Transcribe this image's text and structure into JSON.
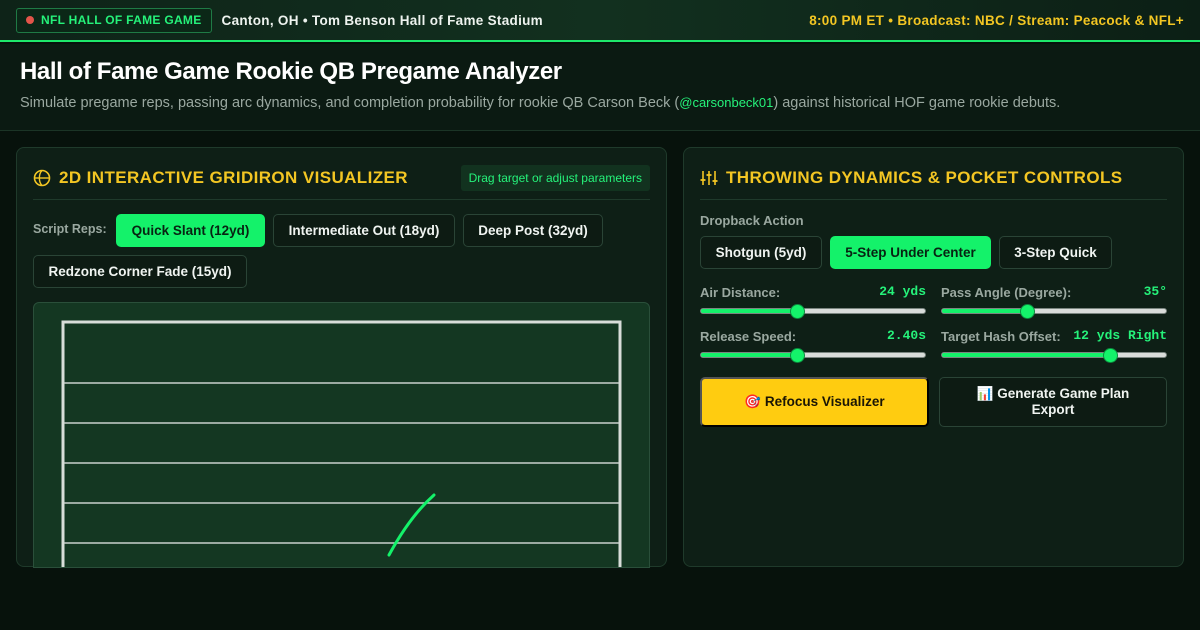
{
  "topbar": {
    "badge": "NFL HALL OF FAME GAME",
    "location": "Canton, OH • Tom Benson Hall of Fame Stadium",
    "broadcast": "8:00 PM ET • Broadcast: NBC / Stream: Peacock & NFL+"
  },
  "header": {
    "title": "Hall of Fame Game Rookie QB Pregame Analyzer",
    "subtitle_before": "Simulate pregame reps, passing arc dynamics, and completion probability for rookie QB Carson Beck (",
    "handle": "@carsonbeck01",
    "subtitle_after": ") against historical HOF game rookie debuts."
  },
  "visualizer": {
    "icon": "football-icon",
    "title": "2D INTERACTIVE GRIDIRON VISUALIZER",
    "hint": "Drag target or adjust parameters",
    "reps_label": "Script Reps:",
    "reps": [
      {
        "label": "Quick Slant (12yd)",
        "active": true
      },
      {
        "label": "Intermediate Out (18yd)",
        "active": false
      },
      {
        "label": "Deep Post (32yd)",
        "active": false
      },
      {
        "label": "Redzone Corner Fade (15yd)",
        "active": false
      }
    ]
  },
  "controls": {
    "icon": "sliders-icon",
    "title": "THROWING DYNAMICS & POCKET CONTROLS",
    "dropback_label": "Dropback Action",
    "dropbacks": [
      {
        "label": "Shotgun (5yd)",
        "active": false
      },
      {
        "label": "5-Step Under Center",
        "active": true
      },
      {
        "label": "3-Step Quick",
        "active": false
      }
    ],
    "sliders": {
      "air_distance": {
        "label": "Air Distance:",
        "value": "24 yds",
        "fraction": 0.43
      },
      "pass_angle": {
        "label": "Pass Angle (Degree):",
        "value": "35°",
        "fraction": 0.38
      },
      "release_speed": {
        "label": "Release Speed:",
        "value": "2.40s",
        "fraction": 0.43
      },
      "hash_offset": {
        "label": "Target Hash Offset:",
        "value": "12 yds Right",
        "fraction": 0.75
      }
    },
    "refocus_label": "🎯 Refocus Visualizer",
    "export_label": "📊 Generate Game Plan Export"
  },
  "colors": {
    "accent_green": "#14f26a",
    "accent_gold": "#f3c623",
    "refocus_yellow": "#ffcc10"
  }
}
